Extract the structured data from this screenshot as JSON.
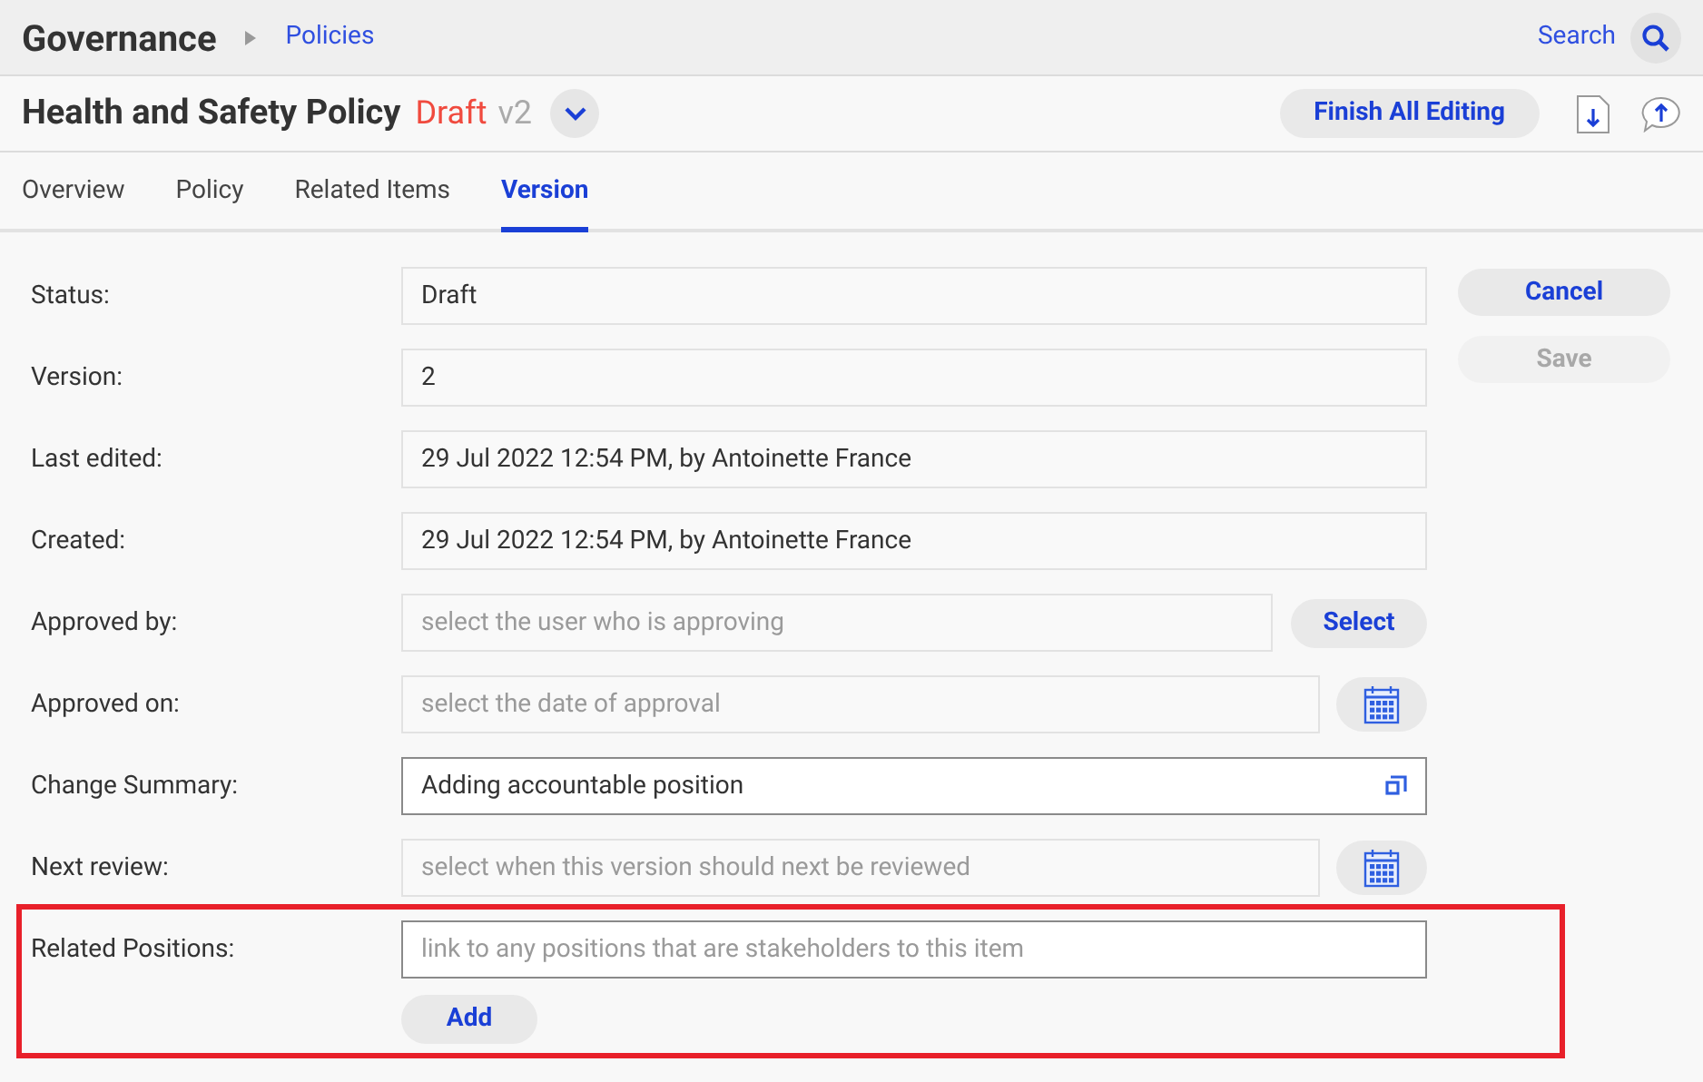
{
  "header": {
    "title": "Governance",
    "breadcrumb": "Policies",
    "search_label": "Search"
  },
  "record": {
    "title": "Health and Safety Policy",
    "status": "Draft",
    "version": "v2",
    "finish_button": "Finish All Editing"
  },
  "tabs": [
    {
      "label": "Overview",
      "selected": false
    },
    {
      "label": "Policy",
      "selected": false
    },
    {
      "label": "Related Items",
      "selected": false
    },
    {
      "label": "Version",
      "selected": true
    }
  ],
  "actions": [
    {
      "label": "Cancel",
      "disabled": false
    },
    {
      "label": "Save",
      "disabled": true
    }
  ],
  "fields": [
    {
      "kind": "readonly",
      "label": "Status:",
      "value": "Draft",
      "highlighted": false
    },
    {
      "kind": "readonly",
      "label": "Version:",
      "value": "2",
      "highlighted": false
    },
    {
      "kind": "readonly",
      "label": "Last edited:",
      "value": "29 Jul 2022 12:54 PM, by Antoinette France",
      "highlighted": false
    },
    {
      "kind": "readonly",
      "label": "Created:",
      "value": "29 Jul 2022 12:54 PM, by Antoinette France",
      "highlighted": false
    },
    {
      "kind": "lookup",
      "label": "Approved by:",
      "placeholder": "select the user who is approving",
      "button": "Select",
      "highlighted": false
    },
    {
      "kind": "date",
      "label": "Approved on:",
      "placeholder": "select the date of approval",
      "highlighted": false
    },
    {
      "kind": "text",
      "label": "Change Summary:",
      "value": "Adding accountable position",
      "highlighted": false
    },
    {
      "kind": "date",
      "label": "Next review:",
      "placeholder": "select when this version should next be reviewed",
      "highlighted": false
    },
    {
      "kind": "multi",
      "label": "Related Positions:",
      "placeholder": "link to any positions that are stakeholders to this item",
      "button": "Add",
      "highlighted": true
    }
  ]
}
